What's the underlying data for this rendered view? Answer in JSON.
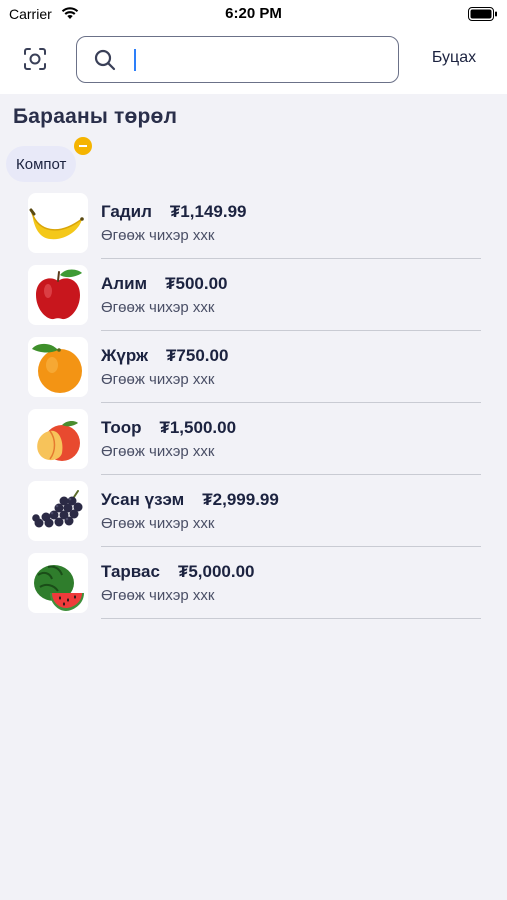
{
  "status_bar": {
    "carrier": "Carrier",
    "time": "6:20 PM"
  },
  "header": {
    "search": {
      "value": "",
      "placeholder": ""
    },
    "cancel_label": "Буцах"
  },
  "section": {
    "title": "Барааны төрөл"
  },
  "filter_chip": {
    "label": "Компот"
  },
  "products": [
    {
      "name": "Гадил",
      "price": "₮1,149.99",
      "description": "Өгөөж чихэр ххк",
      "icon": "banana-icon"
    },
    {
      "name": "Алим",
      "price": "₮500.00",
      "description": "Өгөөж чихэр ххк",
      "icon": "apple-icon"
    },
    {
      "name": "Жүрж",
      "price": "₮750.00",
      "description": "Өгөөж чихэр ххк",
      "icon": "orange-icon"
    },
    {
      "name": "Тоор",
      "price": "₮1,500.00",
      "description": "Өгөөж чихэр ххк",
      "icon": "peach-icon"
    },
    {
      "name": "Усан үзэм",
      "price": "₮2,999.99",
      "description": "Өгөөж чихэр ххк",
      "icon": "grapes-icon"
    },
    {
      "name": "Тарвас",
      "price": "₮5,000.00",
      "description": "Өгөөж чихэр ххк",
      "icon": "watermelon-icon"
    }
  ],
  "colors": {
    "accent": "#2d7ff9",
    "chip_bg": "#e8e9f8",
    "chip_badge": "#f5b400",
    "text": "#1c2340"
  }
}
